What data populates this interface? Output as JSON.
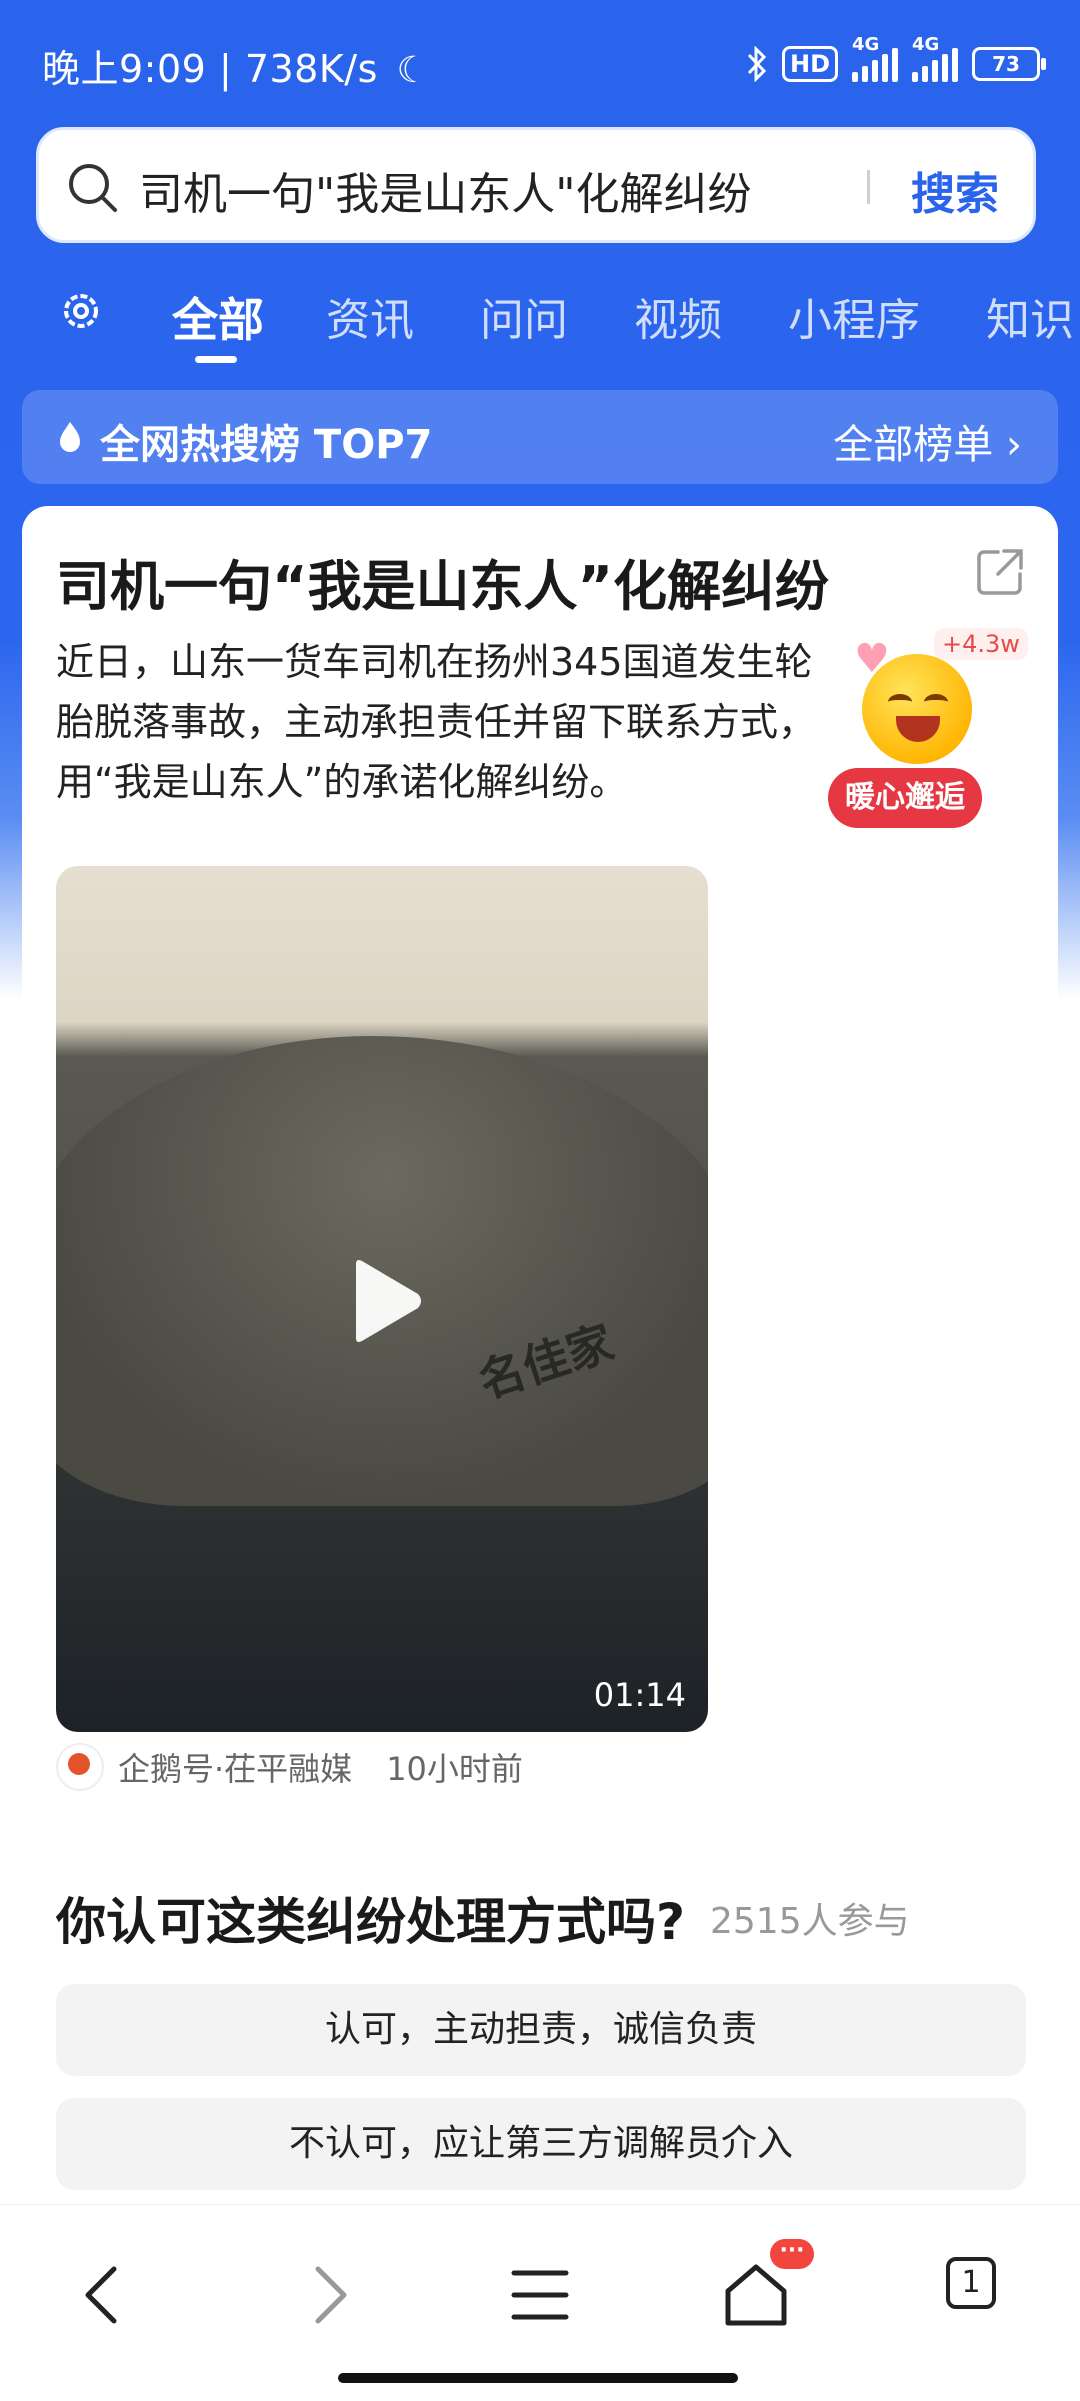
{
  "status_bar": {
    "time": "晚上9:09",
    "net_speed": "738K/s",
    "hd_label": "HD",
    "network_1": "4G",
    "network_2": "4G",
    "battery": "73"
  },
  "search": {
    "query": "司机一句\"我是山东人\"化解纠纷",
    "button_label": "搜索"
  },
  "tabs": [
    {
      "label": "全部",
      "active": true
    },
    {
      "label": "资讯",
      "active": false
    },
    {
      "label": "问问",
      "active": false
    },
    {
      "label": "视频",
      "active": false
    },
    {
      "label": "小程序",
      "active": false
    },
    {
      "label": "知识",
      "active": false
    }
  ],
  "hot_bar": {
    "title": "全网热搜榜  TOP7",
    "all_label": "全部榜单 ›"
  },
  "card": {
    "title": "司机一句“我是山东人”化解纠纷",
    "description": "近日，山东一货车司机在扬州345国道发生轮胎脱落事故，主动承担责任并留下联系方式，用“我是山东人”的承诺化解纠纷。",
    "reaction_count": "+4.3w",
    "reaction_badge": "暖心邂逅",
    "video": {
      "duration": "01:14",
      "watermark_text": "名佳家"
    },
    "source": "企鹅号·茌平融媒",
    "time": "10小时前"
  },
  "poll": {
    "question": "你认可这类纠纷处理方式吗?",
    "participants": "2515人参与",
    "options": [
      "认可，主动担责，诚信负责",
      "不认可，应让第三方调解员介入"
    ]
  },
  "bottom_nav": {
    "home_badge": "···",
    "tab_count": "1"
  },
  "colors": {
    "accent": "#2a63ec",
    "badge_red": "#e53843"
  }
}
